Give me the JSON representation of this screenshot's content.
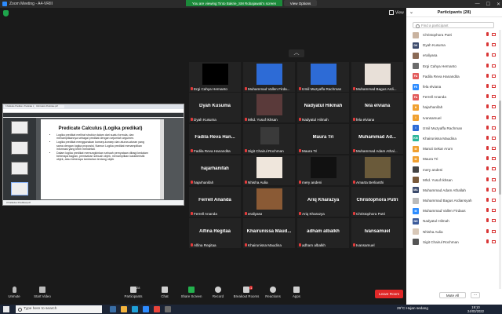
{
  "window": {
    "title": "Zoom Meeting - A4-VRIII"
  },
  "banner": {
    "sharing_text": "You are viewing Tinto Bakrie_SM Robajawati's screen",
    "view_options": "View Options"
  },
  "view_label": "View",
  "shared_screen": {
    "tabs": [
      "3 Kalkulus Predikat - Predicate Calc...",
      "Informatics Predicate pdf"
    ],
    "slide_title": "Predicate Calculus (Logika predikat)",
    "bullets": [
      "Logika predikat melihat struktur dalam dari suatu formula, dan menampilkannya sebagai predikat dengan sejumlah argumen.",
      "Logika predikat menggunakan konsep-konsep dan aturan-aturan yang sama dengan logika proposisi. Namun Logika predikat menampilkan informasi yang lebih mendetail.",
      "Dalam logika predikat memungkinkan sebuah pernyataan dibagi kedalam beberapa bagian, pemisahan sebuah objek, menampilkan karakteristik objek, atau beberapa tambahan tentang objek"
    ],
    "status": "3 Kalkulus Predikat.pdf"
  },
  "gallery": [
    {
      "id": "ergi",
      "name": "Ergi Cahya Hernanto",
      "center": ""
    },
    {
      "id": "vallen",
      "name": "Muhammad Vallen Firda...",
      "center": ""
    },
    {
      "id": "izmil",
      "name": "Izmil Muzyaffa Rachman",
      "center": ""
    },
    {
      "id": "bagus",
      "name": "Muhammad Bagus Ardi...",
      "center": ""
    },
    {
      "id": "dyah",
      "name": "Dyah Kusuma",
      "center": "Dyah Kusuma"
    },
    {
      "id": "yusuf",
      "name": "Mhd. Yusuf Ikhsan",
      "center": ""
    },
    {
      "id": "nadyatul",
      "name": "Nadyatul Hilmah",
      "center": "Nadyatul Hikmah"
    },
    {
      "id": "fela",
      "name": "fela elviana",
      "center": "fela elviana"
    },
    {
      "id": "fadila",
      "name": "Fadila Reva Hanandita",
      "center": "Fadila Reva Han..."
    },
    {
      "id": "sigit",
      "name": "Sigit Chairul Rochman",
      "center": ""
    },
    {
      "id": "maura",
      "name": "Maura Tri",
      "center": "Maura Tri"
    },
    {
      "id": "adam",
      "name": "Muhammad Adam Athal...",
      "center": "Muhammad Ad..."
    },
    {
      "id": "hajar",
      "name": "hajarhanifah",
      "center": "hajarhanifah"
    },
    {
      "id": "nhisha",
      "name": "Nhisha Aulia",
      "center": ""
    },
    {
      "id": "mery",
      "name": "mery andeni",
      "center": ""
    },
    {
      "id": "amarta",
      "name": "Amarta Berlianthi",
      "center": ""
    },
    {
      "id": "ferrell",
      "name": "Ferrell Ananda",
      "center": "Ferrell Ananda"
    },
    {
      "id": "eraliyasa",
      "name": "eraliyasa",
      "center": ""
    },
    {
      "id": "ariq",
      "name": "Ariq Kharazya",
      "center": "Ariq Kharazya"
    },
    {
      "id": "christophora",
      "name": "Christophora Putri",
      "center": "Christophora Putri"
    },
    {
      "id": "alfina",
      "name": "Alfina Regitaa",
      "center": "Alfina Regitaa"
    },
    {
      "id": "khairunissa",
      "name": "Khairunissa Maudina",
      "center": "Khairunissa Maud..."
    },
    {
      "id": "adham",
      "name": "adham albalkh",
      "center": "adham albalkh"
    },
    {
      "id": "ivan",
      "name": "Ivansamuel",
      "center": "Ivansamuel"
    }
  ],
  "participants": {
    "header": "Participants (28)",
    "search_placeholder": "Find a participant",
    "list": [
      {
        "name": "Christophora Putri",
        "initials": "",
        "color": "#c9b3a0"
      },
      {
        "name": "Dyah Kusuma",
        "initials": "DK",
        "color": "#3b4a6b"
      },
      {
        "name": "eraliyasa",
        "initials": "",
        "color": "#8a6a55"
      },
      {
        "name": "Ergi Cahya Hernanto",
        "initials": "",
        "color": "#6b6b6b"
      },
      {
        "name": "Fadila Reva Hanandita",
        "initials": "FA",
        "color": "#e25a5a"
      },
      {
        "name": "fela elviana",
        "initials": "FE",
        "color": "#2d8cff"
      },
      {
        "name": "Ferrell Ananda",
        "initials": "FA",
        "color": "#e25a5a"
      },
      {
        "name": "hajarhanifah",
        "initials": "H",
        "color": "#f0a030"
      },
      {
        "name": "Ivansamuel",
        "initials": "I",
        "color": "#f0a030"
      },
      {
        "name": "Izmil Muzyaffa Rachman",
        "initials": "I",
        "color": "#2d6bd6"
      },
      {
        "name": "Khairunissa Maudina",
        "initials": "KM",
        "color": "#2bb59a"
      },
      {
        "name": "Maruti Sekar Arum",
        "initials": "M",
        "color": "#f0a030"
      },
      {
        "name": "Maura Tri",
        "initials": "M",
        "color": "#f0a030"
      },
      {
        "name": "mery andeni",
        "initials": "",
        "color": "#444"
      },
      {
        "name": "Mhd. Yusuf Ikhsan",
        "initials": "",
        "color": "#7a5a3a"
      },
      {
        "name": "Muhammad Adam Athallah",
        "initials": "MA",
        "color": "#3b4a6b"
      },
      {
        "name": "Muhammad Bagus Ardiansyah",
        "initials": "",
        "color": "#bbb"
      },
      {
        "name": "Muhammad Vallen Firdaus",
        "initials": "M",
        "color": "#2d8cff"
      },
      {
        "name": "Nadyatul Hilmah",
        "initials": "NH",
        "color": "#3b5a9a"
      },
      {
        "name": "Nhisha Aulia",
        "initials": "",
        "color": "#d8c8b8"
      },
      {
        "name": "Sigit Chairul Rochman",
        "initials": "",
        "color": "#555"
      }
    ],
    "mute_all": "Mute All",
    "more": "..."
  },
  "toolbar": {
    "unmute": "Unmute",
    "start_video": "Start Video",
    "participants": "Participants",
    "participants_count": "28",
    "chat": "Chat",
    "share_screen": "Share Screen",
    "record": "Record",
    "breakout": "Breakout Rooms",
    "breakout_badge": "1",
    "reactions": "Reactions",
    "apps": "Apps",
    "leave": "Leave Room"
  },
  "taskbar": {
    "search_placeholder": "Type here to search",
    "weather": "29°C  Hujan sedang",
    "time": "19:10",
    "date": "24/03/2022"
  }
}
